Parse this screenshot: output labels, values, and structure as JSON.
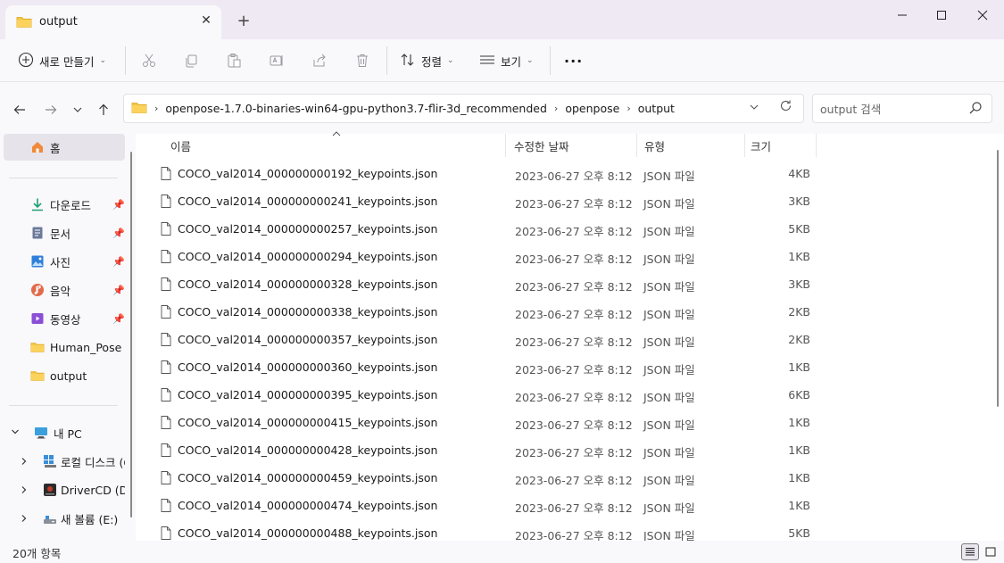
{
  "window": {
    "tab_title": "output",
    "tab_close_icon": "close-icon",
    "new_tab_icon": "plus-icon"
  },
  "toolbar": {
    "new_label": "새로 만들기",
    "sort_label": "정렬",
    "view_label": "보기",
    "more_label": "···"
  },
  "address": {
    "crumbs": [
      "openpose-1.7.0-binaries-win64-gpu-python3.7-flir-3d_recommended",
      "openpose",
      "output"
    ],
    "search_placeholder": "output 검색"
  },
  "sidebar": {
    "home": "홈",
    "quick": [
      {
        "label": "다운로드",
        "icon": "download-icon"
      },
      {
        "label": "문서",
        "icon": "document-icon"
      },
      {
        "label": "사진",
        "icon": "pictures-icon"
      },
      {
        "label": "음악",
        "icon": "music-icon"
      },
      {
        "label": "동영상",
        "icon": "video-icon"
      }
    ],
    "folders": [
      "Human_Pose Es",
      "output"
    ],
    "pc": "내 PC",
    "drives": [
      "로컬 디스크 (C",
      "DriverCD (D:)",
      "새 볼륨 (E:)"
    ]
  },
  "columns": {
    "name": "이름",
    "date": "수정한 날짜",
    "type": "유형",
    "size": "크기"
  },
  "files": [
    {
      "name": "COCO_val2014_000000000192_keypoints.json",
      "date": "2023-06-27 오후 8:12",
      "type": "JSON 파일",
      "size": "4KB"
    },
    {
      "name": "COCO_val2014_000000000241_keypoints.json",
      "date": "2023-06-27 오후 8:12",
      "type": "JSON 파일",
      "size": "3KB"
    },
    {
      "name": "COCO_val2014_000000000257_keypoints.json",
      "date": "2023-06-27 오후 8:12",
      "type": "JSON 파일",
      "size": "5KB"
    },
    {
      "name": "COCO_val2014_000000000294_keypoints.json",
      "date": "2023-06-27 오후 8:12",
      "type": "JSON 파일",
      "size": "1KB"
    },
    {
      "name": "COCO_val2014_000000000328_keypoints.json",
      "date": "2023-06-27 오후 8:12",
      "type": "JSON 파일",
      "size": "3KB"
    },
    {
      "name": "COCO_val2014_000000000338_keypoints.json",
      "date": "2023-06-27 오후 8:12",
      "type": "JSON 파일",
      "size": "2KB"
    },
    {
      "name": "COCO_val2014_000000000357_keypoints.json",
      "date": "2023-06-27 오후 8:12",
      "type": "JSON 파일",
      "size": "2KB"
    },
    {
      "name": "COCO_val2014_000000000360_keypoints.json",
      "date": "2023-06-27 오후 8:12",
      "type": "JSON 파일",
      "size": "1KB"
    },
    {
      "name": "COCO_val2014_000000000395_keypoints.json",
      "date": "2023-06-27 오후 8:12",
      "type": "JSON 파일",
      "size": "6KB"
    },
    {
      "name": "COCO_val2014_000000000415_keypoints.json",
      "date": "2023-06-27 오후 8:12",
      "type": "JSON 파일",
      "size": "1KB"
    },
    {
      "name": "COCO_val2014_000000000428_keypoints.json",
      "date": "2023-06-27 오후 8:12",
      "type": "JSON 파일",
      "size": "1KB"
    },
    {
      "name": "COCO_val2014_000000000459_keypoints.json",
      "date": "2023-06-27 오후 8:12",
      "type": "JSON 파일",
      "size": "1KB"
    },
    {
      "name": "COCO_val2014_000000000474_keypoints.json",
      "date": "2023-06-27 오후 8:12",
      "type": "JSON 파일",
      "size": "1KB"
    },
    {
      "name": "COCO_val2014_000000000488_keypoints.json",
      "date": "2023-06-27 오후 8:12",
      "type": "JSON 파일",
      "size": "5KB"
    }
  ],
  "status": {
    "count": "20개 항목"
  },
  "colors": {
    "folder": "#f4c542",
    "chrome": "#eee9f3",
    "accent": "#2f6fce"
  }
}
